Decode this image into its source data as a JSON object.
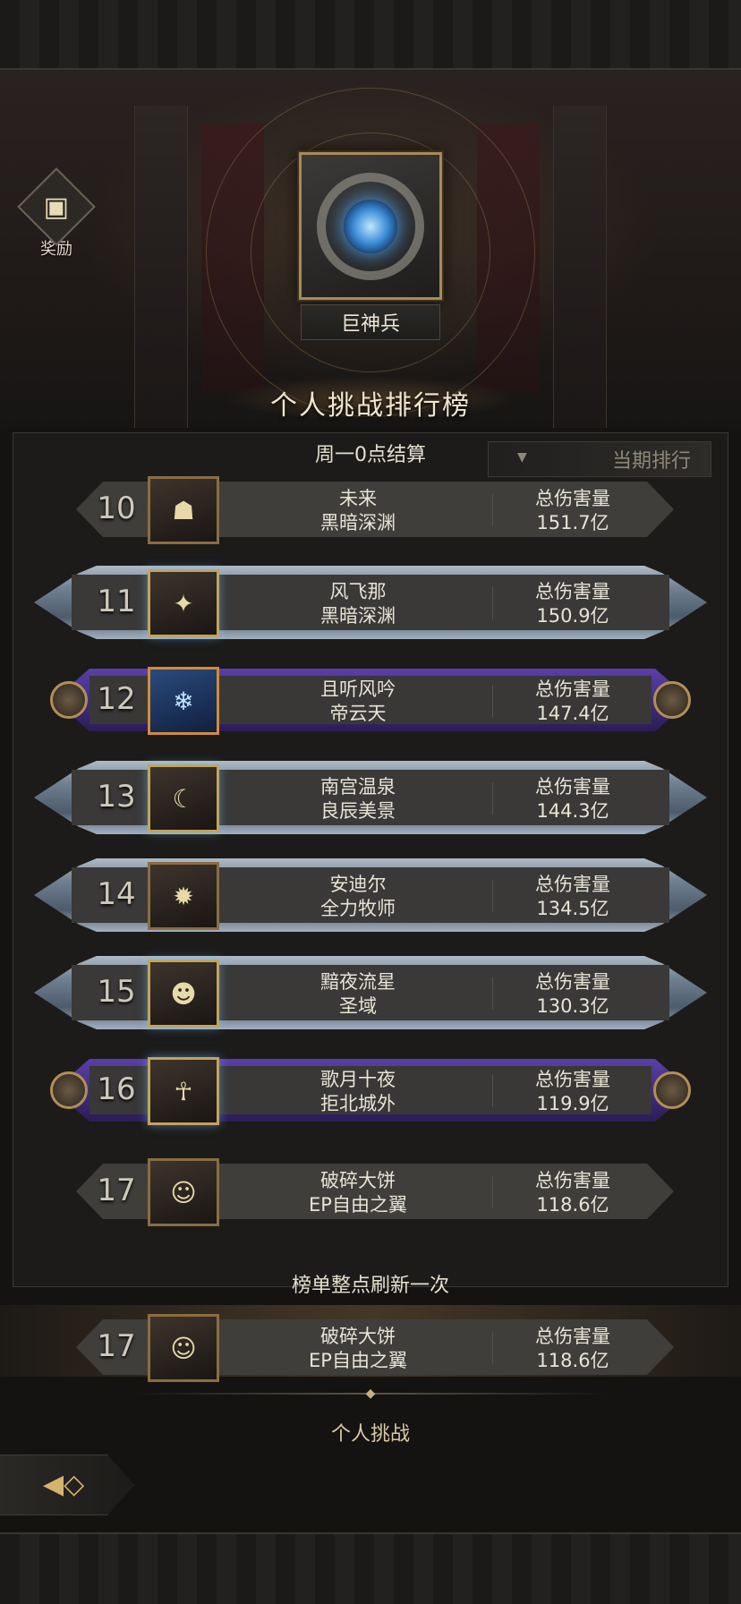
{
  "reward": {
    "label": "奖励",
    "icon": "treasure-chest-icon"
  },
  "boss": {
    "name": "巨神兵"
  },
  "board": {
    "title": "个人挑战排行榜",
    "settle_note": "周一0点结算",
    "period_tab": "当期排行",
    "refresh_note": "榜单整点刷新一次",
    "rows": [
      {
        "rank": "10",
        "player": "未来",
        "guild": "黑暗深渊",
        "score_label": "总伤害量",
        "score": "151.7亿",
        "style": "plain"
      },
      {
        "rank": "11",
        "player": "风飞那",
        "guild": "黑暗深渊",
        "score_label": "总伤害量",
        "score": "150.9亿",
        "style": "frost"
      },
      {
        "rank": "12",
        "player": "且听风吟",
        "guild": "帝云天",
        "score_label": "总伤害量",
        "score": "147.4亿",
        "style": "purple"
      },
      {
        "rank": "13",
        "player": "南宫温泉",
        "guild": "良辰美景",
        "score_label": "总伤害量",
        "score": "144.3亿",
        "style": "frost"
      },
      {
        "rank": "14",
        "player": "安迪尔",
        "guild": "全力牧师",
        "score_label": "总伤害量",
        "score": "134.5亿",
        "style": "frost"
      },
      {
        "rank": "15",
        "player": "黯夜流星",
        "guild": "圣域",
        "score_label": "总伤害量",
        "score": "130.3亿",
        "style": "frost"
      },
      {
        "rank": "16",
        "player": "歌月十夜",
        "guild": "拒北城外",
        "score_label": "总伤害量",
        "score": "119.9亿",
        "style": "purple"
      },
      {
        "rank": "17",
        "player": "破碎大饼",
        "guild": "EP自由之翼",
        "score_label": "总伤害量",
        "score": "118.6亿",
        "style": "plain"
      }
    ],
    "my_row": {
      "rank": "17",
      "player": "破碎大饼",
      "guild": "EP自由之翼",
      "score_label": "总伤害量",
      "score": "118.6亿"
    }
  },
  "tabs": {
    "active": "个人挑战"
  },
  "nav": {
    "back_icon": "back-arrow-icon"
  }
}
